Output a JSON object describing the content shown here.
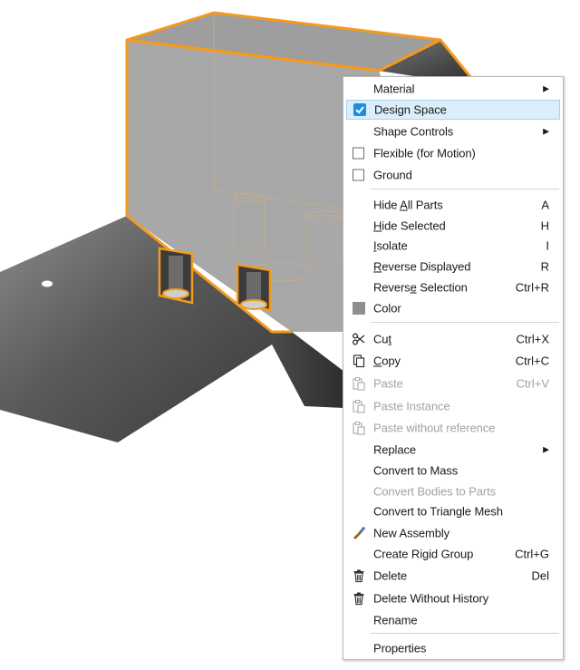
{
  "menu": {
    "items": [
      {
        "label": "Material",
        "submenu": true
      },
      {
        "label": "Design Space",
        "checked": true,
        "selected": true
      },
      {
        "label": "Shape Controls",
        "submenu": true
      },
      {
        "label": "Flexible (for Motion)",
        "checked": false
      },
      {
        "label": "Ground",
        "checked": false
      },
      {
        "label_pre": "Hide ",
        "label_key": "A",
        "label_post": "ll Parts",
        "shortcut": "A"
      },
      {
        "label_pre": "",
        "label_key": "H",
        "label_post": "ide Selected",
        "shortcut": "H"
      },
      {
        "label_pre": "",
        "label_key": "I",
        "label_post": "solate",
        "shortcut": "I"
      },
      {
        "label_pre": "",
        "label_key": "R",
        "label_post": "everse Displayed",
        "shortcut": "R"
      },
      {
        "label_pre": "Revers",
        "label_key": "e",
        "label_post": " Selection",
        "shortcut": "Ctrl+R"
      },
      {
        "label": "Color",
        "icon": "color-swatch-icon"
      },
      {
        "label_pre": "Cu",
        "label_key": "t",
        "label_post": "",
        "shortcut": "Ctrl+X",
        "icon": "scissors-icon"
      },
      {
        "label_pre": "",
        "label_key": "C",
        "label_post": "opy",
        "shortcut": "Ctrl+C",
        "icon": "copy-icon"
      },
      {
        "label": "Paste",
        "shortcut": "Ctrl+V",
        "disabled": true,
        "icon": "paste-icon"
      },
      {
        "label": "Paste Instance",
        "disabled": true,
        "icon": "paste-icon"
      },
      {
        "label": "Paste without reference",
        "disabled": true,
        "icon": "paste-icon"
      },
      {
        "label": "Replace",
        "submenu": true
      },
      {
        "label": "Convert to Mass"
      },
      {
        "label": "Convert Bodies to Parts",
        "disabled": true
      },
      {
        "label": "Convert to Triangle Mesh"
      },
      {
        "label": "New Assembly",
        "icon": "new-assembly-icon"
      },
      {
        "label": "Create Rigid Group",
        "shortcut": "Ctrl+G"
      },
      {
        "label": "Delete",
        "shortcut": "Del",
        "icon": "trash-icon"
      },
      {
        "label": "Delete Without History",
        "icon": "trash-icon"
      },
      {
        "label": "Rename"
      },
      {
        "label": "Properties"
      }
    ]
  },
  "colors": {
    "highlight": "#dbeefa",
    "highlight_border": "#a7d3f0",
    "check_blue": "#1f8ddf",
    "part_outline": "#f59a1b",
    "part_face": "#a6a6a6",
    "plate_dark": "#4a4a4a"
  }
}
